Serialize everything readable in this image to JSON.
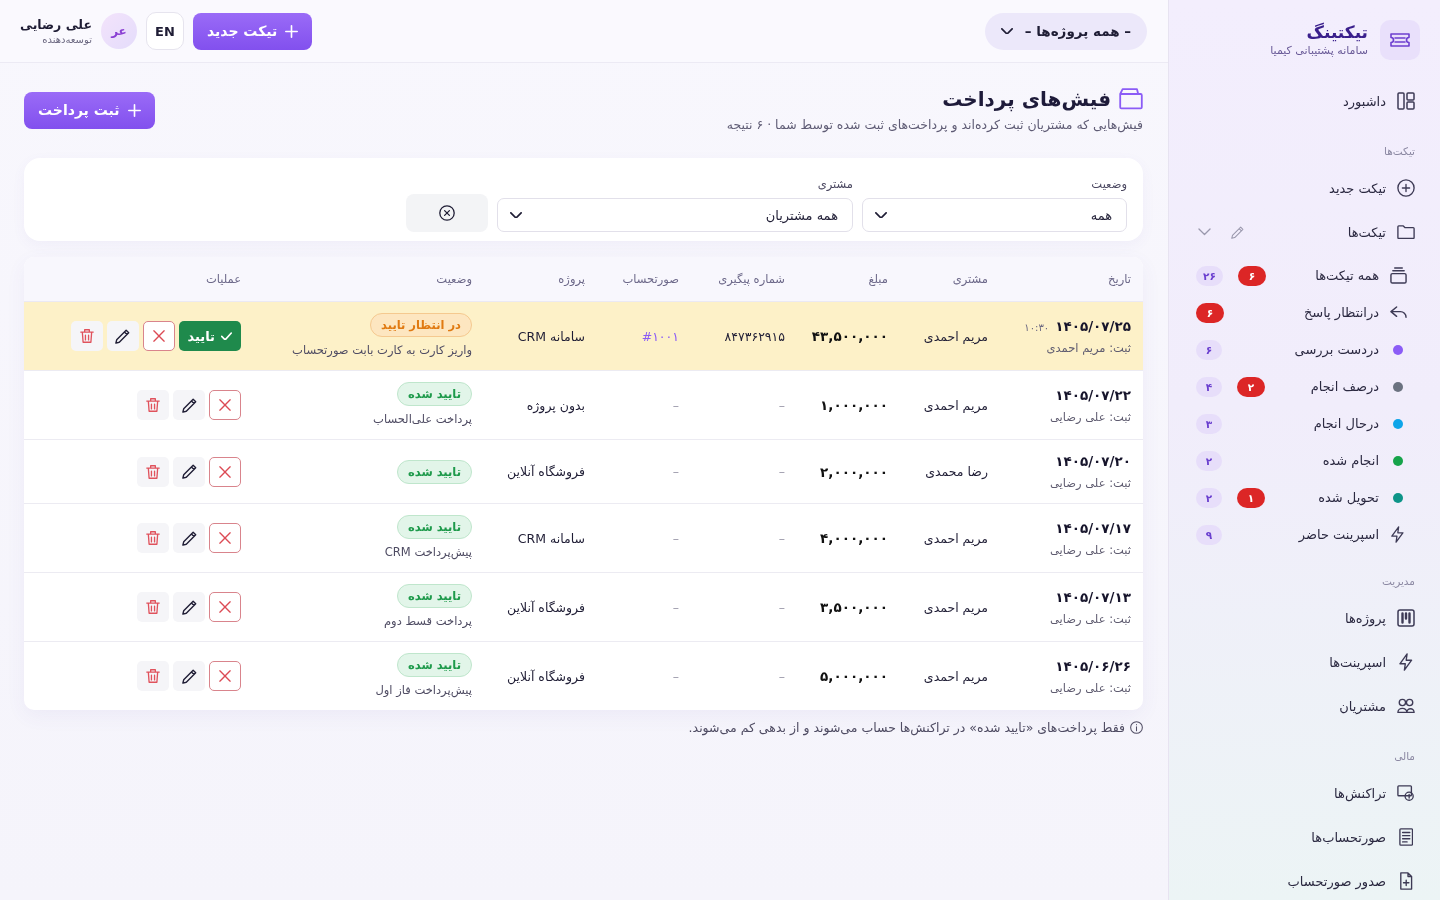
{
  "sidebar": {
    "brand": {
      "title": "تیکتینگ",
      "subtitle": "سامانه پشتیبانی کیمیا"
    },
    "sections": [
      {
        "items": [
          {
            "kind": "link",
            "label": "داشبورد"
          }
        ]
      },
      {
        "heading": "تیکت‌ها",
        "items": [
          {
            "kind": "link",
            "label": "تیکت جدید"
          },
          {
            "kind": "group",
            "label": "تیکت‌ها",
            "expanded": true,
            "children": [
              {
                "kind": "link",
                "label": "همه تیکت‌ها",
                "alert": "۶",
                "count": "۲۶"
              },
              {
                "kind": "link",
                "label": "درانتظار پاسخ",
                "alert": "۶"
              },
              {
                "kind": "status",
                "label": "دردست بررسی",
                "color": "#8b5cf6",
                "count": "۶"
              },
              {
                "kind": "status",
                "label": "درصف انجام",
                "color": "#6b7280",
                "alert": "۲",
                "count": "۴"
              },
              {
                "kind": "status",
                "label": "درحال انجام",
                "color": "#0ea5e9",
                "count": "۳"
              },
              {
                "kind": "status",
                "label": "انجام شده",
                "color": "#16a34a",
                "count": "۲"
              },
              {
                "kind": "status",
                "label": "تحویل شده",
                "color": "#0d9488",
                "alert": "۱",
                "count": "۲"
              },
              {
                "kind": "link",
                "label": "اسپرینت حاضر",
                "count": "۹"
              }
            ]
          }
        ]
      },
      {
        "heading": "مدیریت",
        "items": [
          {
            "kind": "link",
            "label": "پروژه‌ها"
          },
          {
            "kind": "link",
            "label": "اسپرینت‌ها"
          },
          {
            "kind": "link",
            "label": "مشتریان"
          }
        ]
      },
      {
        "heading": "مالی",
        "items": [
          {
            "kind": "link",
            "label": "تراکنش‌ها"
          },
          {
            "kind": "link",
            "label": "صورتحساب‌ها"
          },
          {
            "kind": "link",
            "label": "صدور صورتحساب"
          }
        ]
      }
    ]
  },
  "topbar": {
    "project_selector": "– همه پروژه‌ها –",
    "new_ticket_button": "تیکت جدید",
    "language_button": "EN",
    "user": {
      "initials": "عر",
      "name": "علی رضایی",
      "role": "توسعه‌دهنده"
    }
  },
  "page": {
    "title": "فیش‌های پرداخت",
    "subtitle": "فیش‌هایی که مشتریان ثبت کرده‌اند و پرداخت‌های ثبت شده توسط شما · ۶ نتیجه",
    "add_button": "ثبت پرداخت"
  },
  "filters": {
    "fields": [
      {
        "label": "وضعیت",
        "value": "همه"
      },
      {
        "label": "مشتری",
        "value": "همه مشتریان"
      }
    ]
  },
  "table": {
    "columns": [
      "تاریخ",
      "مشتری",
      "مبلغ",
      "شماره پیگیری",
      "صورتحساب",
      "پروژه",
      "وضعیت",
      "عملیات"
    ],
    "rows": [
      {
        "date": "۱۴۰۵/۰۷/۲۵",
        "time": "۱۰:۳۰",
        "registered_by": "ثبت: مریم احمدی",
        "customer": "مریم احمدی",
        "amount": "۴۳,۵۰۰,۰۰۰",
        "tracking": {
          "kind": "value",
          "text": "۸۴۷۳۶۲۹۱۵"
        },
        "invoice": {
          "kind": "link",
          "text": "#۱۰۰۱"
        },
        "project": "سامانه CRM",
        "status": {
          "kind": "pending",
          "label": "در انتظار تایید"
        },
        "note": "واریز کارت به کارت بابت صورتحساب",
        "actions": [
          {
            "kind": "approve",
            "label": "تایید"
          },
          {
            "kind": "reject"
          },
          {
            "kind": "edit"
          },
          {
            "kind": "delete"
          }
        ]
      },
      {
        "date": "۱۴۰۵/۰۷/۲۲",
        "registered_by": "ثبت: علی رضایی",
        "customer": "مریم احمدی",
        "amount": "۱,۰۰۰,۰۰۰",
        "tracking": {
          "kind": "none",
          "text": "–"
        },
        "invoice": {
          "kind": "none",
          "text": "–"
        },
        "project": "بدون پروژه",
        "status": {
          "kind": "approved",
          "label": "تایید شده"
        },
        "note": "پرداخت علی‌الحساب",
        "actions": [
          {
            "kind": "reject"
          },
          {
            "kind": "edit"
          },
          {
            "kind": "delete"
          }
        ]
      },
      {
        "date": "۱۴۰۵/۰۷/۲۰",
        "registered_by": "ثبت: علی رضایی",
        "customer": "رضا محمدی",
        "amount": "۲,۰۰۰,۰۰۰",
        "tracking": {
          "kind": "none",
          "text": "–"
        },
        "invoice": {
          "kind": "none",
          "text": "–"
        },
        "project": "فروشگاه آنلاین",
        "status": {
          "kind": "approved",
          "label": "تایید شده"
        },
        "actions": [
          {
            "kind": "reject"
          },
          {
            "kind": "edit"
          },
          {
            "kind": "delete"
          }
        ]
      },
      {
        "date": "۱۴۰۵/۰۷/۱۷",
        "registered_by": "ثبت: علی رضایی",
        "customer": "مریم احمدی",
        "amount": "۴,۰۰۰,۰۰۰",
        "tracking": {
          "kind": "none",
          "text": "–"
        },
        "invoice": {
          "kind": "none",
          "text": "–"
        },
        "project": "سامانه CRM",
        "status": {
          "kind": "approved",
          "label": "تایید شده"
        },
        "note": "پیش‌پرداخت CRM",
        "actions": [
          {
            "kind": "reject"
          },
          {
            "kind": "edit"
          },
          {
            "kind": "delete"
          }
        ]
      },
      {
        "date": "۱۴۰۵/۰۷/۱۳",
        "registered_by": "ثبت: علی رضایی",
        "customer": "مریم احمدی",
        "amount": "۳,۵۰۰,۰۰۰",
        "tracking": {
          "kind": "none",
          "text": "–"
        },
        "invoice": {
          "kind": "none",
          "text": "–"
        },
        "project": "فروشگاه آنلاین",
        "status": {
          "kind": "approved",
          "label": "تایید شده"
        },
        "note": "پرداخت قسط دوم",
        "actions": [
          {
            "kind": "reject"
          },
          {
            "kind": "edit"
          },
          {
            "kind": "delete"
          }
        ]
      },
      {
        "date": "۱۴۰۵/۰۶/۲۶",
        "registered_by": "ثبت: علی رضایی",
        "customer": "مریم احمدی",
        "amount": "۵,۰۰۰,۰۰۰",
        "tracking": {
          "kind": "none",
          "text": "–"
        },
        "invoice": {
          "kind": "none",
          "text": "–"
        },
        "project": "فروشگاه آنلاین",
        "status": {
          "kind": "approved",
          "label": "تایید شده"
        },
        "note": "پیش‌پرداخت فاز اول",
        "actions": [
          {
            "kind": "reject"
          },
          {
            "kind": "edit"
          },
          {
            "kind": "delete"
          }
        ]
      }
    ]
  },
  "footer_note": "فقط پرداخت‌های «تایید شده» در تراکنش‌ها حساب می‌شوند و از بدهی کم می‌شوند."
}
